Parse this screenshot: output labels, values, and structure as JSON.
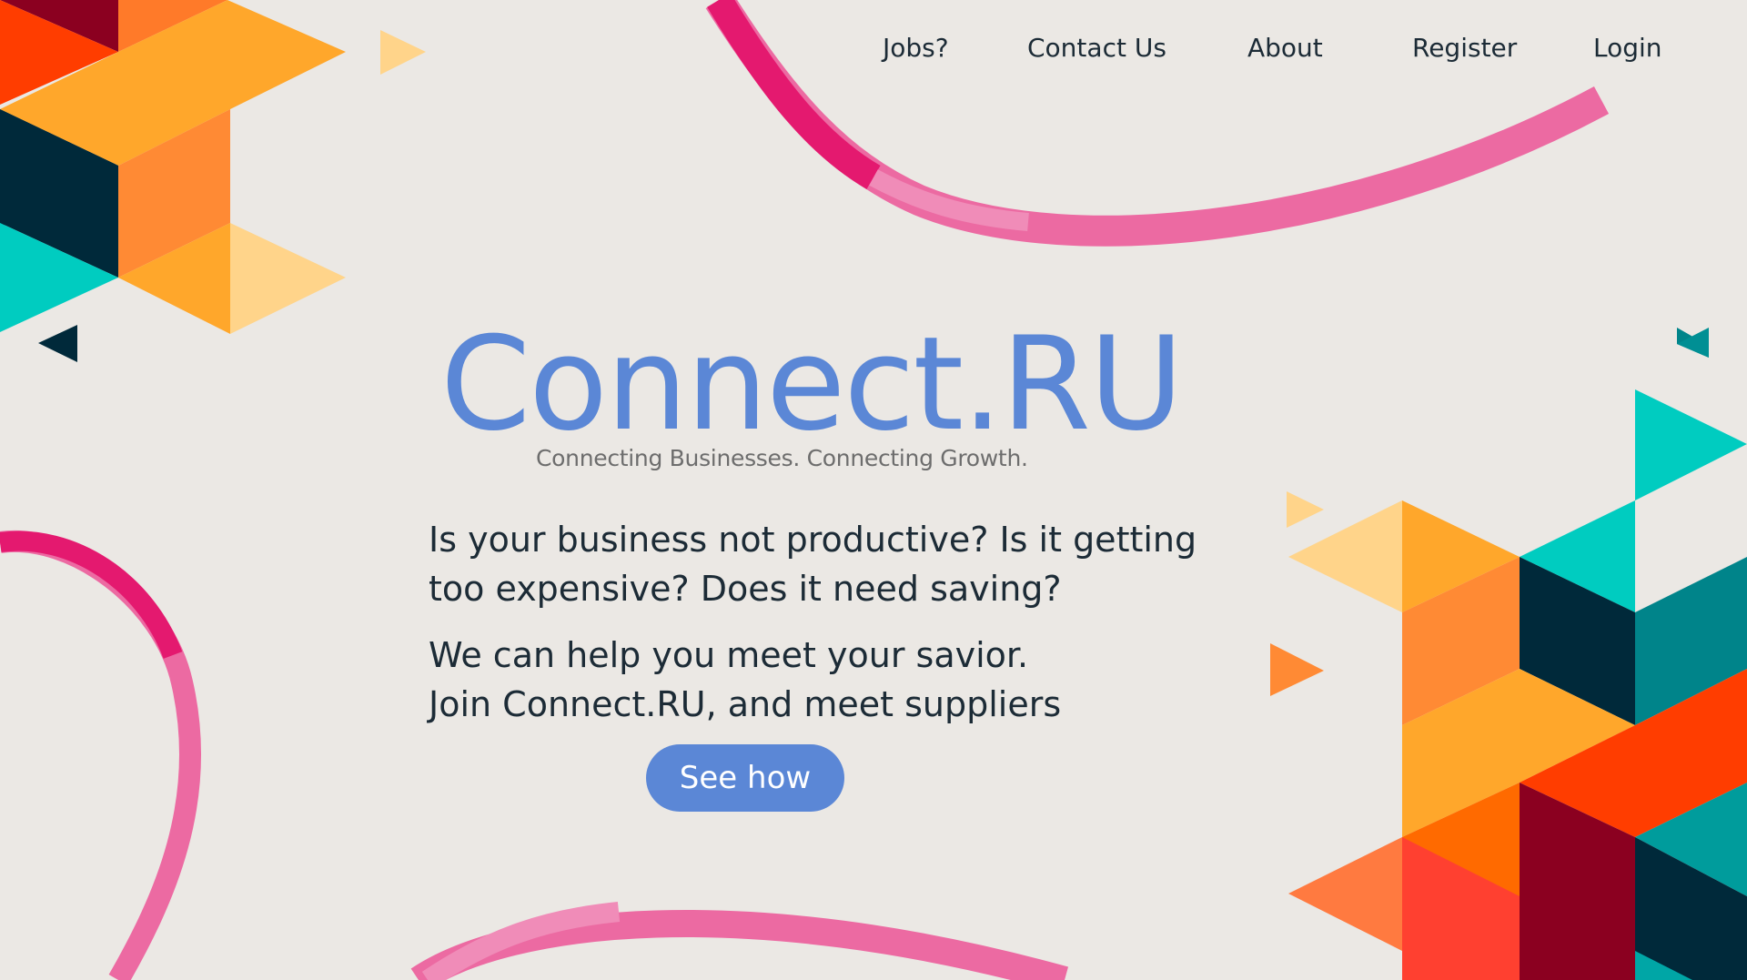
{
  "nav": {
    "items": [
      {
        "label": "Jobs?"
      },
      {
        "label": "Contact Us"
      },
      {
        "label": "About"
      },
      {
        "label": "Register"
      },
      {
        "label": "Login"
      }
    ]
  },
  "hero": {
    "brand": "Connect.RU",
    "tagline": "Connecting Businesses. Connecting Growth.",
    "question_lines": [
      "Is your business not productive? Is it getting",
      "too expensive? Does it need saving?"
    ],
    "pitch_lines": [
      "We can help you meet your savior.",
      "Join Connect.RU, and meet suppliers"
    ],
    "cta_label": "See how"
  },
  "colors": {
    "background": "#ebe8e4",
    "brand_blue": "#5b87d6",
    "text_dark": "#1c2b36",
    "ribbon_pink": "#e91e78",
    "ribbon_light": "#ec6aa2",
    "orange": "#ffa72b",
    "teal": "#00ccc0",
    "navy": "#00293a",
    "red": "#ff3d00"
  }
}
